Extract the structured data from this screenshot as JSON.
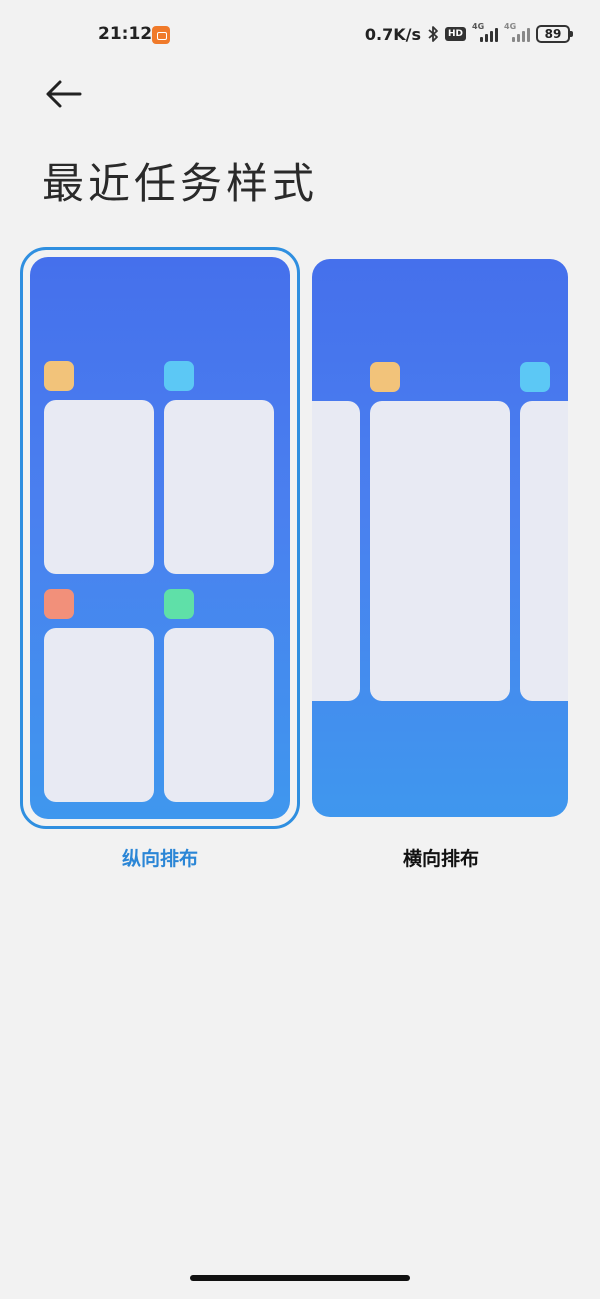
{
  "status_bar": {
    "time": "21:12",
    "network_speed": "0.7K/s",
    "hd_label": "HD",
    "sim1_network": "4G",
    "sim2_network": "4G",
    "battery_level": "89"
  },
  "header": {
    "title": "最近任务样式"
  },
  "options": {
    "vertical": {
      "label": "纵向排布",
      "selected": true
    },
    "horizontal": {
      "label": "横向排布",
      "selected": false
    }
  },
  "colors": {
    "accent": "#2b86d6",
    "preview_blue": "#4570ec",
    "app_orange": "#f2c37a",
    "app_cyan": "#5cc8f5",
    "app_red": "#f2907a",
    "app_green": "#5fe0a8",
    "task_card": "#e8eaf3"
  }
}
